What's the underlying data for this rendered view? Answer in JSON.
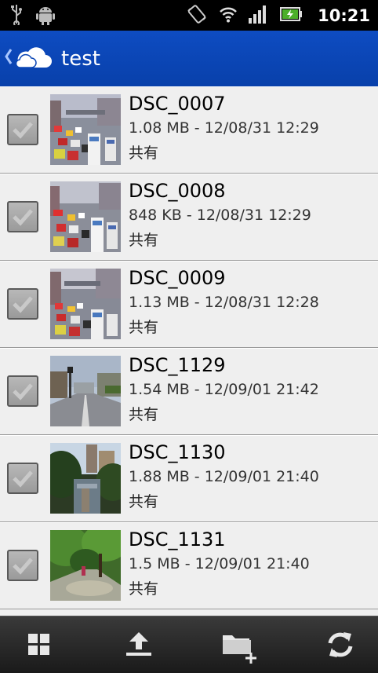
{
  "status_bar": {
    "time": "10:21",
    "icons": [
      "usb-icon",
      "android-debug-icon",
      "vibrate-icon",
      "wifi-icon",
      "signal-icon",
      "battery-charging-icon"
    ]
  },
  "header": {
    "title": "test",
    "back_icon": "chevron-left-icon",
    "logo_icon": "cloud-icon",
    "color": "#0b46b5"
  },
  "files": [
    {
      "name": "DSC_0007",
      "meta": "1.08 MB - 12/08/31 12:29",
      "shared": "共有",
      "thumb": "traffic-street-photo"
    },
    {
      "name": "DSC_0008",
      "meta": "848 KB - 12/08/31 12:29",
      "shared": "共有",
      "thumb": "traffic-street-photo"
    },
    {
      "name": "DSC_0009",
      "meta": "1.13 MB - 12/08/31 12:28",
      "shared": "共有",
      "thumb": "traffic-street-photo"
    },
    {
      "name": "DSC_1129",
      "meta": "1.54 MB - 12/09/01 21:42",
      "shared": "共有",
      "thumb": "empty-road-photo"
    },
    {
      "name": "DSC_1130",
      "meta": "1.88 MB - 12/09/01 21:40",
      "shared": "共有",
      "thumb": "canal-photo"
    },
    {
      "name": "DSC_1131",
      "meta": "1.5 MB - 12/09/01 21:40",
      "shared": "共有",
      "thumb": "park-path-photo"
    }
  ],
  "toolbar": {
    "buttons": [
      "grid-view-icon",
      "upload-icon",
      "new-folder-icon",
      "refresh-icon"
    ]
  }
}
